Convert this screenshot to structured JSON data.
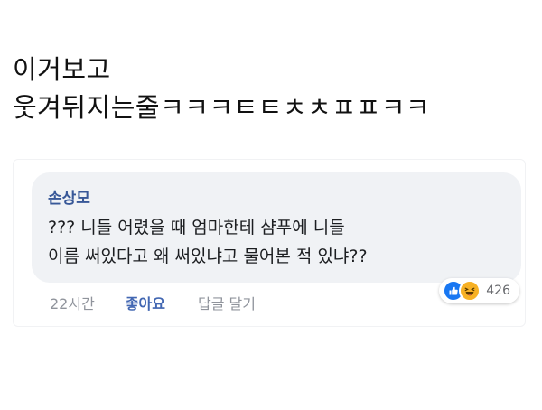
{
  "post": {
    "caption_lines": [
      "이거보고",
      "웃겨뒤지는줄ㅋㅋㅋㅌㅌㅊㅊㅍㅍㅋㅋ"
    ]
  },
  "comment": {
    "author": "손상모",
    "text_lines": [
      "??? 니들 어렸을 때 엄마한테 샴푸에 니들",
      "이름 써있다고 왜 써있냐고 물어본 적 있냐??"
    ],
    "time": "22시간",
    "like_label": "좋아요",
    "reply_label": "답글 달기",
    "reactions": {
      "icons": [
        "like-icon",
        "haha-icon"
      ],
      "count": "426"
    }
  },
  "colors": {
    "author": "#385898",
    "like_action": "#4267b2",
    "like_reaction": "#1877f2",
    "haha_reaction": "#f7b125",
    "muted_text": "#90949c",
    "bubble_bg": "#f0f2f5"
  }
}
